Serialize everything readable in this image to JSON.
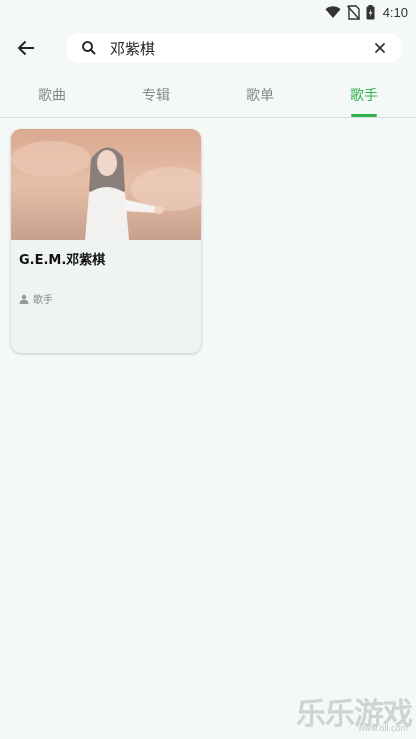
{
  "status_bar": {
    "time": "4:10",
    "icons": [
      "wifi-icon",
      "no-sim-icon",
      "battery-icon"
    ]
  },
  "header": {
    "back_icon": "arrow-left-icon",
    "search": {
      "value": "邓紫棋",
      "icon": "search-icon",
      "clear_icon": "close-icon"
    }
  },
  "tabs": [
    {
      "label": "歌曲",
      "active": false
    },
    {
      "label": "专辑",
      "active": false
    },
    {
      "label": "歌单",
      "active": false
    },
    {
      "label": "歌手",
      "active": true
    }
  ],
  "results": [
    {
      "name": "G.E.M.邓紫棋",
      "type_label": "歌手",
      "type_icon": "person-icon",
      "image": "artist-photo"
    }
  ],
  "watermark": {
    "title": "乐乐游戏",
    "url": "www.6ll.com"
  },
  "colors": {
    "accent": "#2fb34a",
    "background": "#f4f9f8",
    "card": "#eff3f4"
  }
}
